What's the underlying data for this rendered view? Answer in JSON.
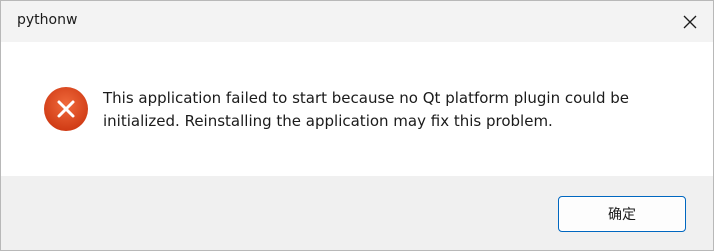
{
  "window": {
    "title": "pythonw"
  },
  "dialog": {
    "icon": "error-icon",
    "message": "This application failed to start because no Qt platform plugin could be\ninitialized. Reinstalling the application may fix this problem."
  },
  "buttons": {
    "ok_label": "确定"
  },
  "colors": {
    "error_red": "#e2481f",
    "accent_blue": "#0067c0",
    "footer_bg": "#f0f0f0",
    "titlebar_bg": "#f3f3f3"
  }
}
